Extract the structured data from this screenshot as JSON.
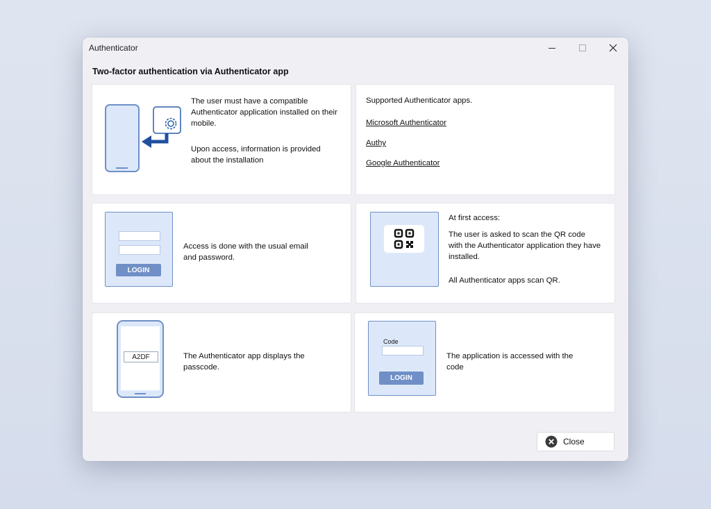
{
  "window": {
    "title": "Authenticator",
    "heading": "Two-factor authentication via Authenticator app"
  },
  "cards": {
    "install": {
      "text1": "The user must have a compatible Authenticator application installed on their mobile.",
      "text2": "Upon access, information is provided about the installation"
    },
    "supported": {
      "title": "Supported Authenticator apps.",
      "apps": [
        "Microsoft Authenticator",
        "Authy",
        "Google Authenticator"
      ]
    },
    "login": {
      "text": "Access is done with the usual email and password.",
      "button": "LOGIN"
    },
    "qr": {
      "title": "At first access:",
      "text1": "The user is asked to scan the QR code with the Authenticator application they have installed.",
      "text2": "All Authenticator apps scan QR."
    },
    "passcode": {
      "code": "A2DF",
      "text": "The Authenticator app displays the passcode."
    },
    "code_login": {
      "field_label": "Code",
      "button": "LOGIN",
      "text": "The application is accessed with the code"
    }
  },
  "footer": {
    "close_label": "Close"
  },
  "colors": {
    "accent": "#2d5fa8",
    "illustration_fill": "#dce8fa",
    "illustration_stroke": "#6f8fc6"
  },
  "icons": [
    "minimize-icon",
    "maximize-icon",
    "close-icon",
    "phone-icon",
    "gear-icon",
    "arrow-left-icon",
    "qr-code-icon",
    "close-circle-icon"
  ]
}
